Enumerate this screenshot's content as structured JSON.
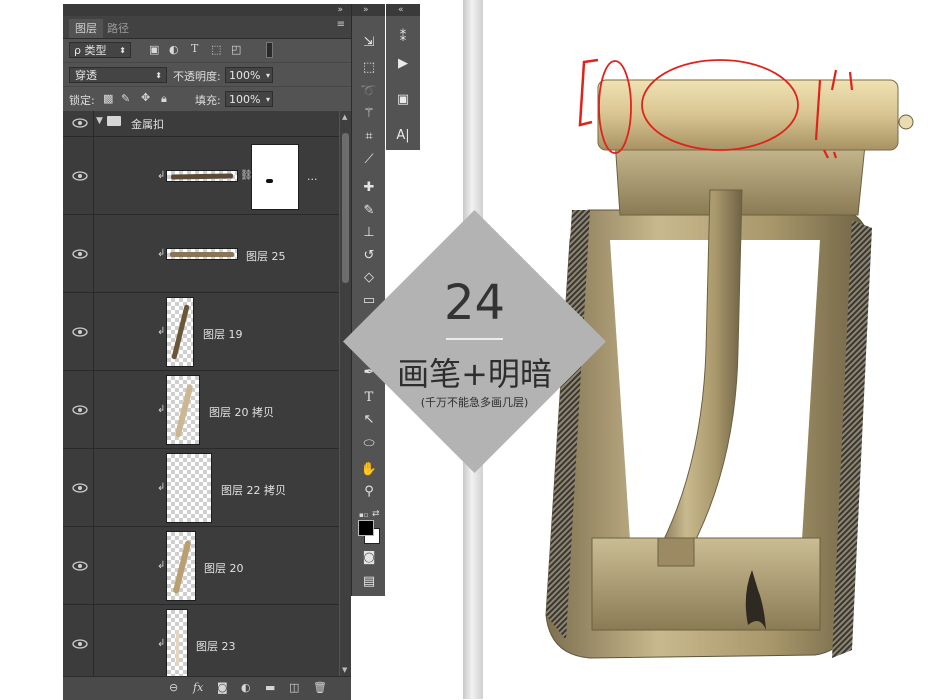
{
  "layers_panel": {
    "tabs": [
      "图层",
      "路径"
    ],
    "filter_type": "ρ 类型",
    "blend_mode": "穿透",
    "opacity_label": "不透明度:",
    "opacity_value": "100%",
    "lock_label": "锁定:",
    "fill_label": "填充:",
    "fill_value": "100%",
    "group_name": "金属扣",
    "layers": [
      {
        "name": "",
        "has_mask": true,
        "more": "..."
      },
      {
        "name": "图层 25"
      },
      {
        "name": "图层 19"
      },
      {
        "name": "图层 20 拷贝"
      },
      {
        "name": "图层 22 拷贝"
      },
      {
        "name": "图层 20"
      },
      {
        "name": "图层 23"
      }
    ],
    "footer_icons": [
      "link-icon",
      "fx-icon",
      "mask-icon",
      "adjustment-icon",
      "folder-icon",
      "new-layer-icon",
      "trash-icon"
    ]
  },
  "toolbar": {
    "tools": [
      "move",
      "marquee",
      "lasso",
      "magic-wand",
      "crop",
      "eyedropper",
      "healing",
      "brush",
      "stamp",
      "history-brush",
      "eraser",
      "gradient",
      "pen",
      "type",
      "path-select",
      "shape",
      "hand",
      "zoom"
    ]
  },
  "mini_panel": {
    "type_label": "A|"
  },
  "badge": {
    "number": "24",
    "title": "画笔+明暗",
    "subtitle": "(千万不能急多画几层)"
  },
  "colors": {
    "panel_bg": "#535353",
    "list_bg": "#3c3c3c",
    "diamond": "#b3b3b3",
    "annotation_red": "#e0231a",
    "brass": "#b8a47a"
  }
}
